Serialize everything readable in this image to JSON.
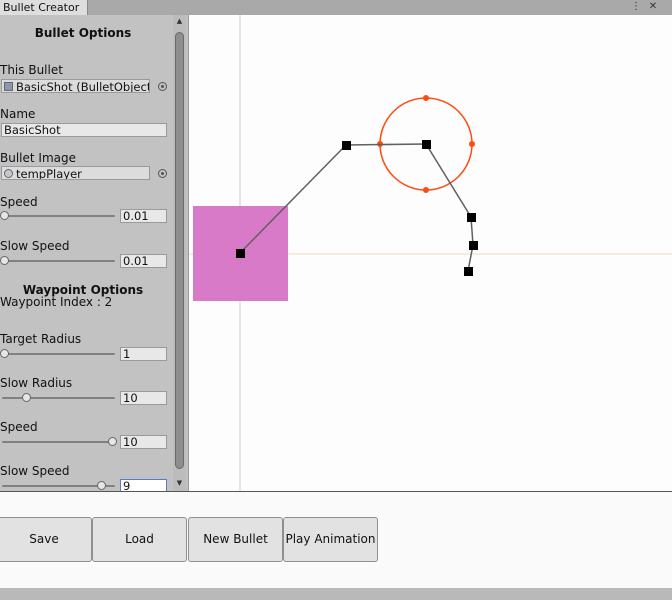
{
  "window": {
    "tab_title": "Bullet Creator",
    "menu_icon": "kebab-menu-icon",
    "close_icon": "close-icon"
  },
  "bullet_options": {
    "heading": "Bullet Options",
    "this_bullet_label": "This Bullet",
    "this_bullet_value": "BasicShot (BulletObject)",
    "name_label": "Name",
    "name_value": "BasicShot",
    "image_label": "Bullet Image",
    "image_value": "tempPlayer",
    "speed_label": "Speed",
    "speed_value": "0.01",
    "speed_fraction": 0.0,
    "slow_speed_label": "Slow Speed",
    "slow_speed_value": "0.01",
    "slow_speed_fraction": 0.0
  },
  "waypoint_options": {
    "heading": "Waypoint Options",
    "index_text": "Waypoint Index : 2",
    "target_radius_label": "Target Radius",
    "target_radius_value": "1",
    "target_radius_fraction": 0.0,
    "slow_radius_label": "Slow Radius",
    "slow_radius_value": "10",
    "slow_radius_fraction": 0.2,
    "speed_label": "Speed",
    "speed_value": "10",
    "speed_fraction": 1.0,
    "slow_speed_label": "Slow Speed",
    "slow_speed_value": "9",
    "slow_speed_fraction": 0.9
  },
  "buttons": {
    "save": "Save",
    "load": "Load",
    "new_bullet": "New Bullet",
    "play_animation": "Play Animation"
  },
  "colors": {
    "bullet_sprite": "#d87ac8",
    "radius_circle": "#ff4a10",
    "path_line": "#606060",
    "waypoint": "#000000",
    "guide_line": "#e8e0b8",
    "guide_vline": "#c8cce0"
  }
}
